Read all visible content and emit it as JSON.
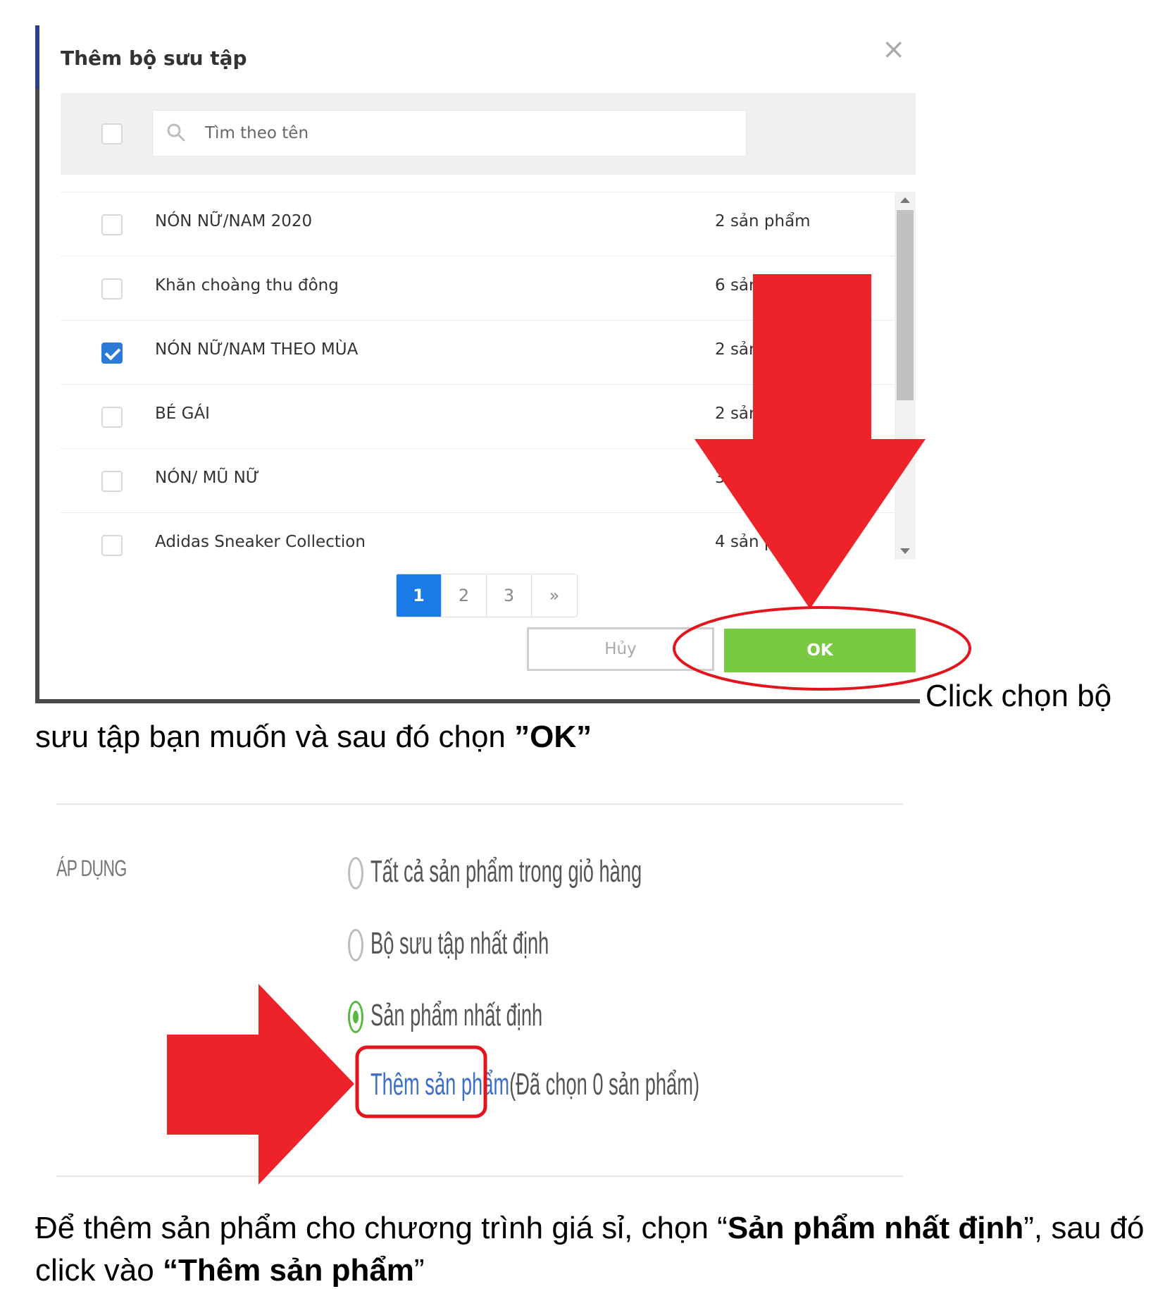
{
  "modal": {
    "title": "Thêm bộ sưu tập",
    "close_symbol": "×",
    "search_placeholder": "Tìm theo tên",
    "collections": [
      {
        "name": "NÓN NỮ/NAM 2020",
        "count": "2 sản phẩm",
        "checked": false
      },
      {
        "name": "Khăn choàng thu đông",
        "count": "6 sản phẩm",
        "checked": false
      },
      {
        "name": "NÓN NỮ/NAM THEO MÙA",
        "count": "2 sản phẩm",
        "checked": true
      },
      {
        "name": "BÉ GÁI",
        "count": "2 sản phẩm",
        "checked": false
      },
      {
        "name": "NÓN/ MŨ NỮ",
        "count": "3 sản phẩm",
        "checked": false
      },
      {
        "name": "Adidas Sneaker Collection",
        "count": "4 sản phẩm",
        "checked": false
      }
    ],
    "pagination": {
      "pages": [
        "1",
        "2",
        "3"
      ],
      "next": "»",
      "current": "1"
    },
    "cancel_label": "Hủy",
    "ok_label": "OK"
  },
  "caption1": {
    "line1": "Click chọn bộ",
    "line2_text": "sưu tập bạn muốn và sau đó chọn ",
    "line2_bold": "”OK”"
  },
  "apply_section": {
    "label": "ÁP DỤNG",
    "options": [
      {
        "label": "Tất cả sản phẩm trong giỏ hàng",
        "selected": false
      },
      {
        "label": "Bộ sưu tập nhất định",
        "selected": false
      },
      {
        "label": "Sản phẩm nhất định",
        "selected": true
      }
    ],
    "add_link": "Thêm sản phẩm",
    "selected_info": "(Đã chọn 0 sản phẩm)"
  },
  "caption2": {
    "p1": "Để thêm sản phẩm cho chương trình giá sỉ, chọn “",
    "b1": "Sản phẩm nhất định",
    "p2": "”, sau đó click vào ",
    "b2": "“Thêm sản phẩm",
    "p3": "”"
  },
  "colors": {
    "accent_blue": "#1a7ae6",
    "ok_green": "#7ac943",
    "annotation_red": "#ee2229",
    "link_blue": "#3d6fc7",
    "radio_green": "#56b83d"
  }
}
